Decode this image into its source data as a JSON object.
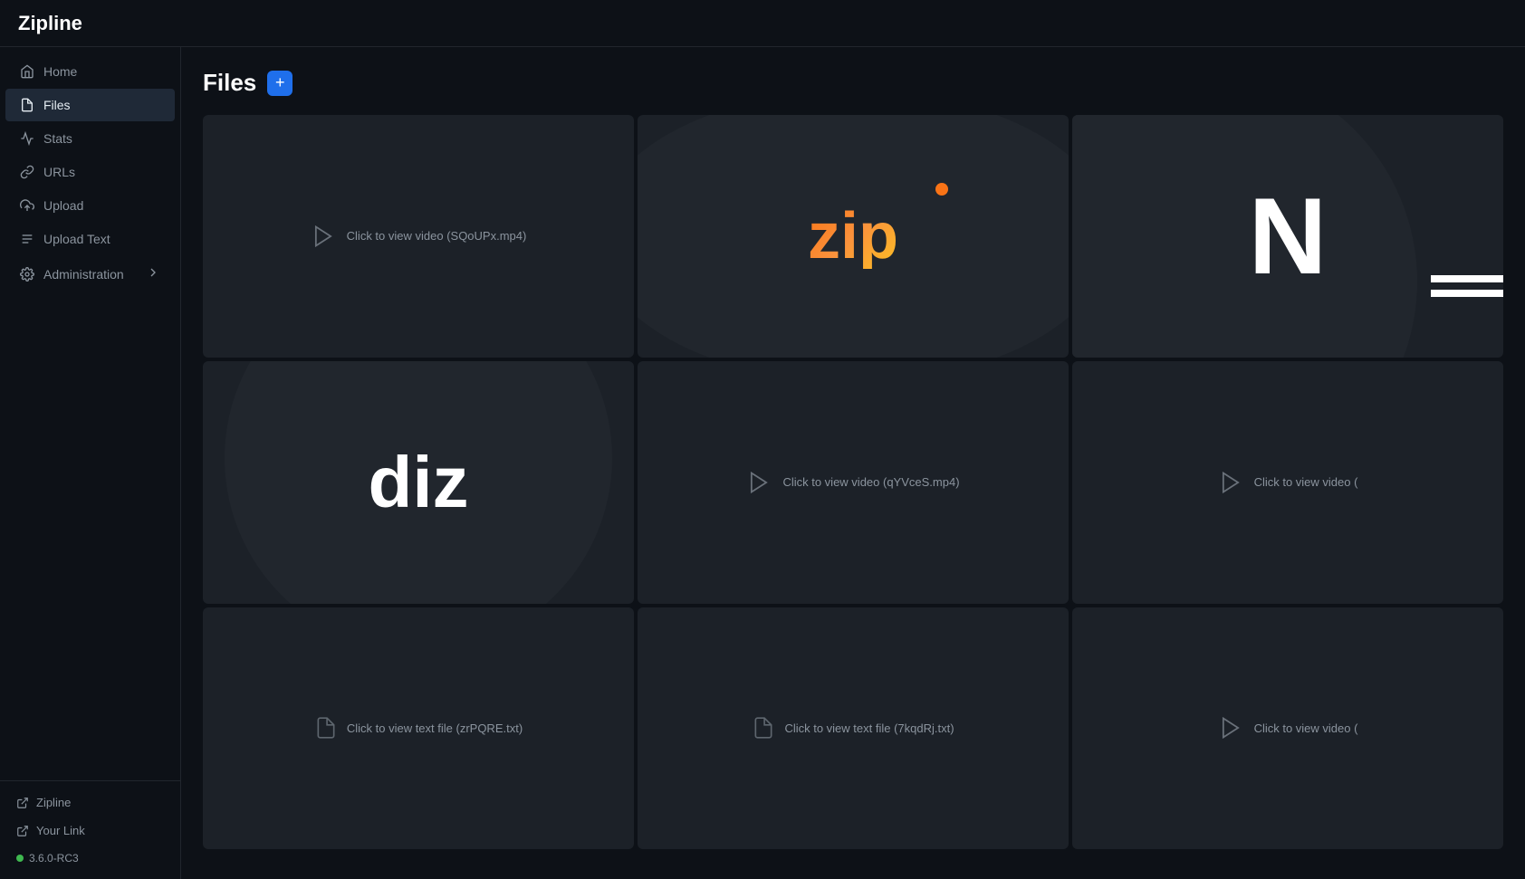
{
  "app": {
    "title": "Zipline",
    "version": "3.6.0-RC3"
  },
  "sidebar": {
    "items": [
      {
        "id": "home",
        "label": "Home",
        "icon": "home-icon",
        "active": false
      },
      {
        "id": "files",
        "label": "Files",
        "icon": "files-icon",
        "active": true
      },
      {
        "id": "stats",
        "label": "Stats",
        "icon": "stats-icon",
        "active": false
      },
      {
        "id": "urls",
        "label": "URLs",
        "icon": "link-icon",
        "active": false
      },
      {
        "id": "upload",
        "label": "Upload",
        "icon": "upload-icon",
        "active": false
      },
      {
        "id": "upload-text",
        "label": "Upload Text",
        "icon": "text-icon",
        "active": false
      },
      {
        "id": "administration",
        "label": "Administration",
        "icon": "gear-icon",
        "active": false,
        "hasChevron": true
      }
    ],
    "footer": [
      {
        "id": "zipline-link",
        "label": "Zipline"
      },
      {
        "id": "your-link",
        "label": "Your Link"
      }
    ]
  },
  "files": {
    "title": "Files",
    "add_button_label": "+",
    "cards": [
      {
        "id": "card-1",
        "type": "video",
        "label": "Click to view video (SQoUPx.mp4)"
      },
      {
        "id": "card-2",
        "type": "zip",
        "text": "zip"
      },
      {
        "id": "card-3",
        "type": "n-partial"
      },
      {
        "id": "card-4",
        "type": "diz",
        "text": "diz"
      },
      {
        "id": "card-5",
        "type": "video",
        "label": "Click to view video (qYVceS.mp4)"
      },
      {
        "id": "card-6",
        "type": "video-partial",
        "label": "Click to view video ("
      },
      {
        "id": "card-7",
        "type": "text",
        "label": "Click to view text file (zrPQRE.txt)"
      },
      {
        "id": "card-8",
        "type": "text",
        "label": "Click to view text file (7kqdRj.txt)"
      },
      {
        "id": "card-9",
        "type": "video",
        "label": "Click to view video ("
      }
    ]
  }
}
